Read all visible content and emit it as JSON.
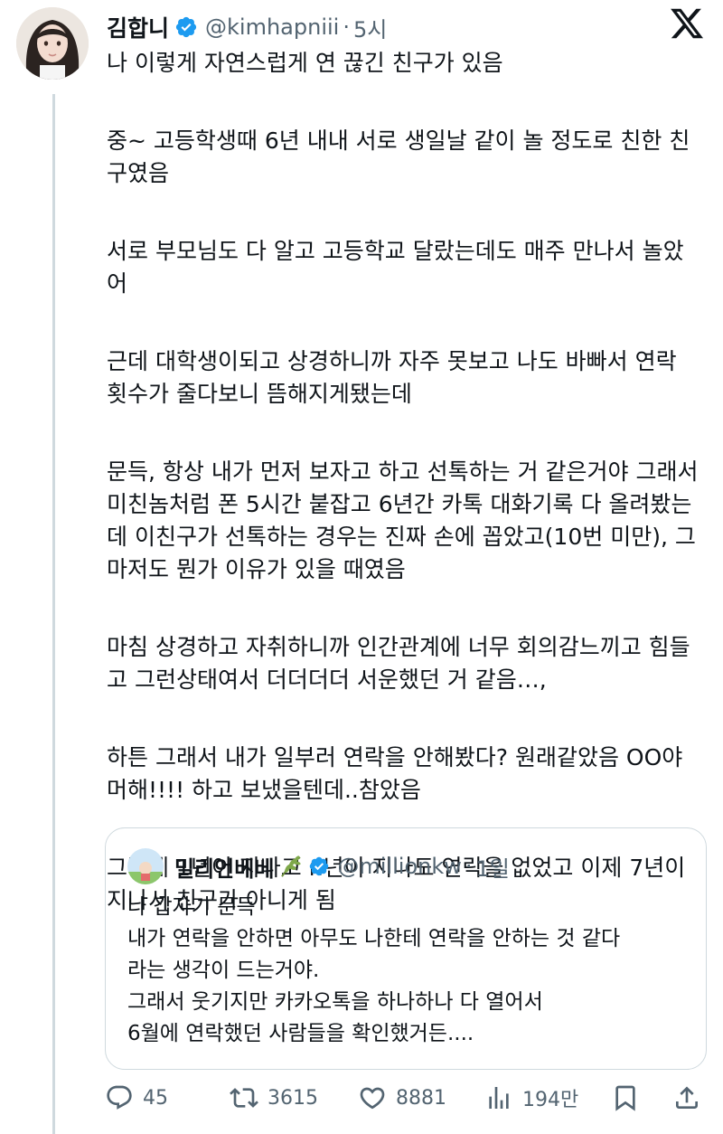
{
  "tweet": {
    "display_name": "김합니",
    "handle": "@kimhapniii",
    "separator": "·",
    "time": "5시",
    "paragraphs": [
      "나 이렇게 자연스럽게 연 끊긴 친구가 있음",
      "중~ 고등학생때 6년 내내 서로 생일날 같이 놀 정도로 친한 친구였음",
      "서로 부모님도 다 알고 고등학교 달랐는데도 매주 만나서 놀았어",
      "근데 대학생이되고 상경하니까 자주 못보고 나도 바빠서 연락 횟수가 줄다보니 뜸해지게됐는데",
      "문득,  항상 내가 먼저 보자고 하고 선톡하는 거 같은거야 그래서 미친놈처럼 폰 5시간 붙잡고 6년간 카톡 대화기록 다 올려봤는데 이친구가 선톡하는 경우는 진짜 손에 꼽았고(10번 미만), 그 마저도 뭔가 이유가 있을 때였음",
      "마침 상경하고 자취하니까 인간관계에 너무 회의감느끼고 힘들고 그런상태여서 더더더더 서운했던 거 같음…,",
      "하튼 그래서 내가 일부러 연락을 안해봤다? 원래같았음 OO야 머해!!!! 하고 보냈을텐데..참았음",
      "그렇게 1년이 지나고 n년이 지나도 연락을 없었고 이제 7년이 지나서 친구가 아니게 됨"
    ]
  },
  "quote": {
    "display_name": "밀리언베베",
    "handle": "@millionkw",
    "separator": "·",
    "time": "1일",
    "lines": [
      "나 갑자기 문득",
      "내가 연락을 안하면 아무도 나한테 연락을 안하는 것 같다",
      "라는 생각이 드는거야.",
      "그래서 웃기지만 카카오톡을 하나하나 다 열어서",
      "6월에 연락했던 사람들을 확인했거든...."
    ]
  },
  "actions": {
    "replies": "45",
    "retweets": "3615",
    "likes": "8881",
    "views": "194만"
  },
  "icons": [
    "verified-icon",
    "x-logo-icon",
    "leaf-icon",
    "reply-icon",
    "retweet-icon",
    "like-icon",
    "views-icon",
    "bookmark-icon",
    "share-icon"
  ],
  "colors": {
    "text": "#0f1419",
    "secondary": "#536471",
    "verified": "#1d9bf0",
    "border": "#cfd9de"
  }
}
